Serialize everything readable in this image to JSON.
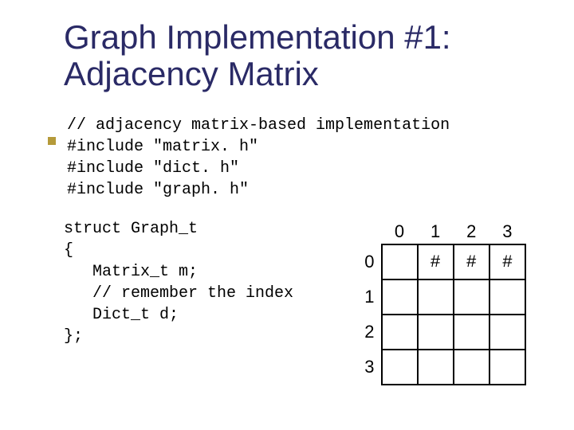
{
  "title_line1": "Graph Implementation #1:",
  "title_line2": "Adjacency Matrix",
  "code": {
    "l1": "// adjacency matrix-based implementation",
    "l2": "#include \"matrix. h\"",
    "l3": "#include \"dict. h\"",
    "l4": "#include \"graph. h\""
  },
  "struct": {
    "l1": "struct Graph_t",
    "l2": "{",
    "l3": "   Matrix_t m;",
    "l4": "   // remember the index",
    "l5": "   Dict_t d;",
    "l6": "};"
  },
  "matrix": {
    "col_headers": [
      "0",
      "1",
      "2",
      "3"
    ],
    "row_headers": [
      "0",
      "1",
      "2",
      "3"
    ],
    "cells": [
      [
        "",
        "#",
        "#",
        "#"
      ],
      [
        "",
        "",
        "",
        ""
      ],
      [
        "",
        "",
        "",
        ""
      ],
      [
        "",
        "",
        "",
        ""
      ]
    ]
  }
}
